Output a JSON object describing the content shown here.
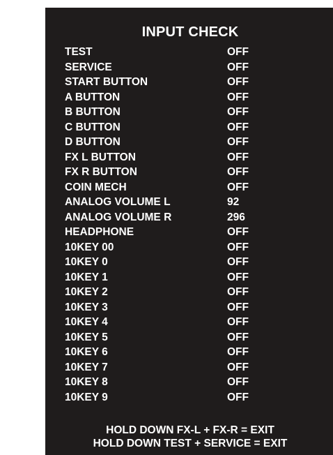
{
  "title": "INPUT CHECK",
  "rows": [
    {
      "label": "TEST",
      "value": "OFF"
    },
    {
      "label": "SERVICE",
      "value": "OFF"
    },
    {
      "label": "START BUTTON",
      "value": "OFF"
    },
    {
      "label": "A BUTTON",
      "value": "OFF"
    },
    {
      "label": "B BUTTON",
      "value": "OFF"
    },
    {
      "label": "C BUTTON",
      "value": "OFF"
    },
    {
      "label": "D BUTTON",
      "value": "OFF"
    },
    {
      "label": "FX L BUTTON",
      "value": "OFF"
    },
    {
      "label": "FX R BUTTON",
      "value": "OFF"
    },
    {
      "label": "COIN MECH",
      "value": "OFF"
    },
    {
      "label": "ANALOG VOLUME L",
      "value": "92"
    },
    {
      "label": "ANALOG VOLUME R",
      "value": "296"
    },
    {
      "label": "HEADPHONE",
      "value": "OFF"
    },
    {
      "label": "10KEY 00",
      "value": "OFF"
    },
    {
      "label": "10KEY 0",
      "value": "OFF"
    },
    {
      "label": "10KEY 1",
      "value": "OFF"
    },
    {
      "label": "10KEY 2",
      "value": "OFF"
    },
    {
      "label": "10KEY 3",
      "value": "OFF"
    },
    {
      "label": "10KEY 4",
      "value": "OFF"
    },
    {
      "label": "10KEY 5",
      "value": "OFF"
    },
    {
      "label": "10KEY 6",
      "value": "OFF"
    },
    {
      "label": "10KEY 7",
      "value": "OFF"
    },
    {
      "label": "10KEY 8",
      "value": "OFF"
    },
    {
      "label": "10KEY 9",
      "value": "OFF"
    }
  ],
  "footer": {
    "line1": "HOLD DOWN FX-L + FX-R = EXIT",
    "line2": "HOLD DOWN TEST + SERVICE = EXIT"
  },
  "colors": {
    "screen_background": "#1f1c1c",
    "text": "#ffffff",
    "page_background": "#ffffff"
  }
}
